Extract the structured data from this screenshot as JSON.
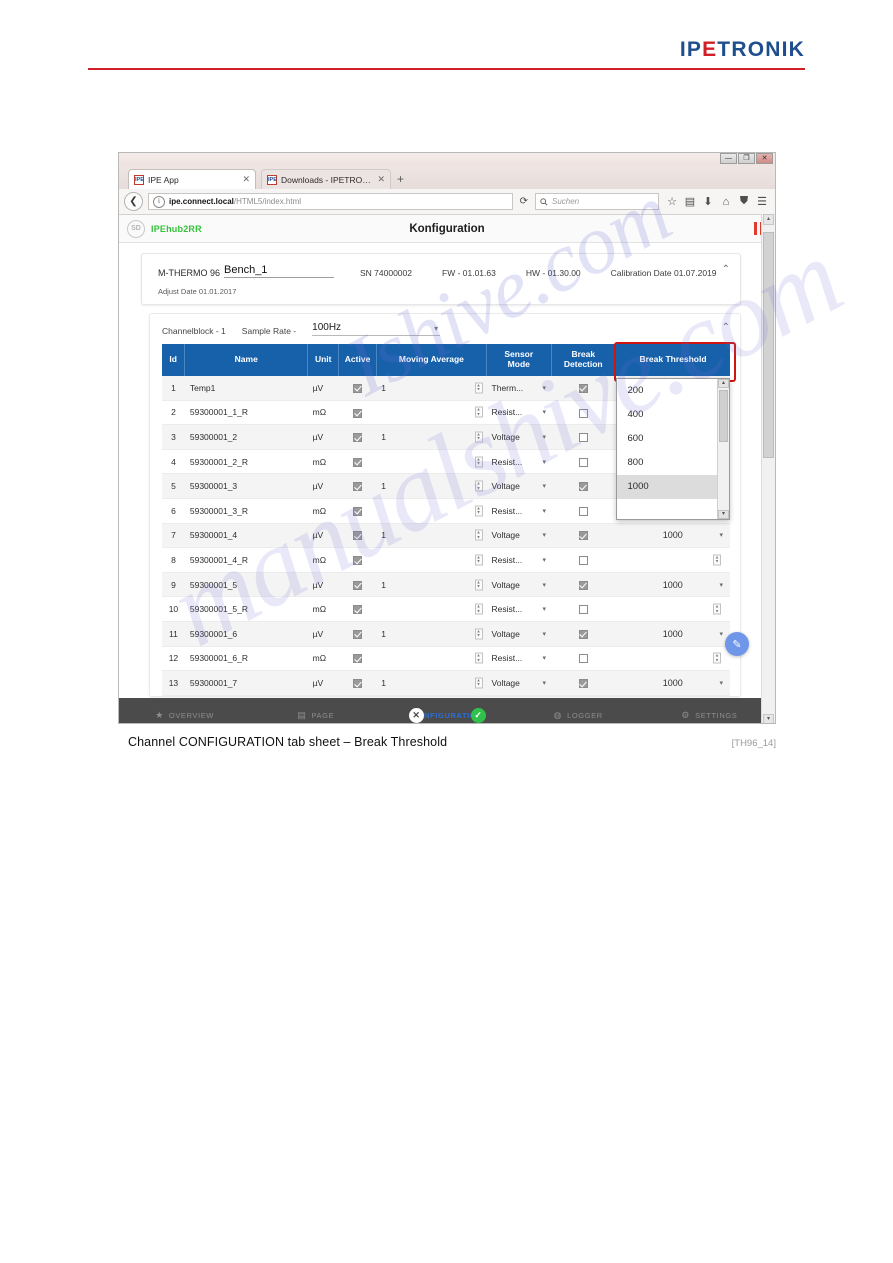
{
  "page": {
    "logo": {
      "part1": "IP",
      "part2": "E",
      "part3": "TRONIK"
    },
    "caption": "Channel CONFIGURATION tab sheet – Break Threshold",
    "caption_ref": "[TH96_14]",
    "watermark_1": "manualshive.com",
    "watermark_2": "Ishive.com"
  },
  "browser": {
    "window_buttons": {
      "minimize": "—",
      "maximize": "❐",
      "close": "✕"
    },
    "tabs": [
      {
        "favicon": "IPE",
        "title": "IPE App",
        "close": "✕",
        "active": true
      },
      {
        "favicon": "IPE",
        "title": "Downloads - IPETRONIK G...",
        "close": "✕",
        "active": false
      }
    ],
    "new_tab": "+",
    "back_icon": "❮",
    "url": {
      "host": "ipe.connect.local",
      "path": "/HTML5/index.html"
    },
    "reload_icon": "⟳",
    "search_placeholder": "Suchen",
    "toolbar_icons": [
      "bookmark-star-icon",
      "library-icon",
      "downloads-icon",
      "home-icon",
      "shield-icon",
      "menu-icon"
    ]
  },
  "app": {
    "sd_badge": "SD",
    "device_id": "IPEhub2RR",
    "title": "Konfiguration",
    "pause_label": "pause-icon"
  },
  "device": {
    "model": "M-THERMO 96",
    "name": "Bench_1",
    "serial": "SN 74000002",
    "firmware": "FW - 01.01.63",
    "hardware": "HW - 01.30.00",
    "calibration": "Calibration Date 01.07.2019",
    "adjust": "Adjust Date 01.01.2017",
    "collapse_icon": "⌃"
  },
  "block": {
    "channelblock_label": "Channelblock - 1",
    "sample_rate_label": "Sample Rate -",
    "sample_rate_value": "100Hz",
    "caret": "▾",
    "collapse_icon": "⌃"
  },
  "table": {
    "columns": [
      {
        "key": "id",
        "label": "Id"
      },
      {
        "key": "name",
        "label": "Name"
      },
      {
        "key": "unit",
        "label": "Unit"
      },
      {
        "key": "active",
        "label": "Active"
      },
      {
        "key": "moving_average",
        "label": "Moving Average"
      },
      {
        "key": "sensor_mode",
        "label": "Sensor\nMode"
      },
      {
        "key": "break_detection",
        "label": "Break\nDetection"
      },
      {
        "key": "break_threshold",
        "label": "Break Threshold"
      }
    ],
    "header_labels": {
      "id": "Id",
      "name": "Name",
      "unit": "Unit",
      "active": "Active",
      "moving_average": "Moving Average",
      "sensor_mode_l1": "Sensor",
      "sensor_mode_l2": "Mode",
      "break_detection_l1": "Break",
      "break_detection_l2": "Detection",
      "break_threshold": "Break Threshold"
    },
    "rows": [
      {
        "id": "1",
        "name": "Temp1",
        "unit": "µV",
        "active": true,
        "moving_average": "1",
        "sensor_mode": "Therm...",
        "break_detection": true,
        "break_threshold": ""
      },
      {
        "id": "2",
        "name": "59300001_1_R",
        "unit": "mΩ",
        "active": true,
        "moving_average": "",
        "sensor_mode": "Resist...",
        "break_detection": false,
        "break_threshold": ""
      },
      {
        "id": "3",
        "name": "59300001_2",
        "unit": "µV",
        "active": true,
        "moving_average": "1",
        "sensor_mode": "Voltage",
        "break_detection": false,
        "break_threshold": ""
      },
      {
        "id": "4",
        "name": "59300001_2_R",
        "unit": "mΩ",
        "active": true,
        "moving_average": "",
        "sensor_mode": "Resist...",
        "break_detection": false,
        "break_threshold": ""
      },
      {
        "id": "5",
        "name": "59300001_3",
        "unit": "µV",
        "active": true,
        "moving_average": "1",
        "sensor_mode": "Voltage",
        "break_detection": true,
        "break_threshold": ""
      },
      {
        "id": "6",
        "name": "59300001_3_R",
        "unit": "mΩ",
        "active": true,
        "moving_average": "",
        "sensor_mode": "Resist...",
        "break_detection": false,
        "break_threshold": ""
      },
      {
        "id": "7",
        "name": "59300001_4",
        "unit": "µV",
        "active": true,
        "moving_average": "1",
        "sensor_mode": "Voltage",
        "break_detection": true,
        "break_threshold": "1000"
      },
      {
        "id": "8",
        "name": "59300001_4_R",
        "unit": "mΩ",
        "active": true,
        "moving_average": "",
        "sensor_mode": "Resist...",
        "break_detection": false,
        "break_threshold": ""
      },
      {
        "id": "9",
        "name": "59300001_5",
        "unit": "µV",
        "active": true,
        "moving_average": "1",
        "sensor_mode": "Voltage",
        "break_detection": true,
        "break_threshold": "1000"
      },
      {
        "id": "10",
        "name": "59300001_5_R",
        "unit": "mΩ",
        "active": true,
        "moving_average": "",
        "sensor_mode": "Resist...",
        "break_detection": false,
        "break_threshold": ""
      },
      {
        "id": "11",
        "name": "59300001_6",
        "unit": "µV",
        "active": true,
        "moving_average": "1",
        "sensor_mode": "Voltage",
        "break_detection": true,
        "break_threshold": "1000"
      },
      {
        "id": "12",
        "name": "59300001_6_R",
        "unit": "mΩ",
        "active": true,
        "moving_average": "",
        "sensor_mode": "Resist...",
        "break_detection": false,
        "break_threshold": ""
      },
      {
        "id": "13",
        "name": "59300001_7",
        "unit": "µV",
        "active": true,
        "moving_average": "1",
        "sensor_mode": "Voltage",
        "break_detection": true,
        "break_threshold": "1000"
      }
    ]
  },
  "dropdown": {
    "options": [
      "200",
      "400",
      "600",
      "800",
      "1000"
    ],
    "selected": "1000",
    "up_arrow": "▴",
    "down_arrow": "▾"
  },
  "bottom_nav": [
    {
      "icon": "star-icon",
      "label": "OVERVIEW",
      "active": false
    },
    {
      "icon": "page-icon",
      "label": "PAGE",
      "active": false
    },
    {
      "icon": "config-icon",
      "label": "CONFIGURATION",
      "active": true
    },
    {
      "icon": "logger-icon",
      "label": "LOGGER",
      "active": false
    },
    {
      "icon": "gear-icon",
      "label": "SETTINGS",
      "active": false
    }
  ],
  "badges": {
    "cancel": "✕",
    "confirm": "✓"
  },
  "fab": {
    "icon": "edit-pencil-icon"
  },
  "colors": {
    "table_header_blue": "#1761ab",
    "highlight_red": "#d0140f",
    "brand_blue": "#1f4e8c",
    "brand_red": "#cf2027",
    "device_green": "#35c13a",
    "nav_active_blue": "#2b6fd6",
    "confirm_green": "#2fc14c"
  }
}
